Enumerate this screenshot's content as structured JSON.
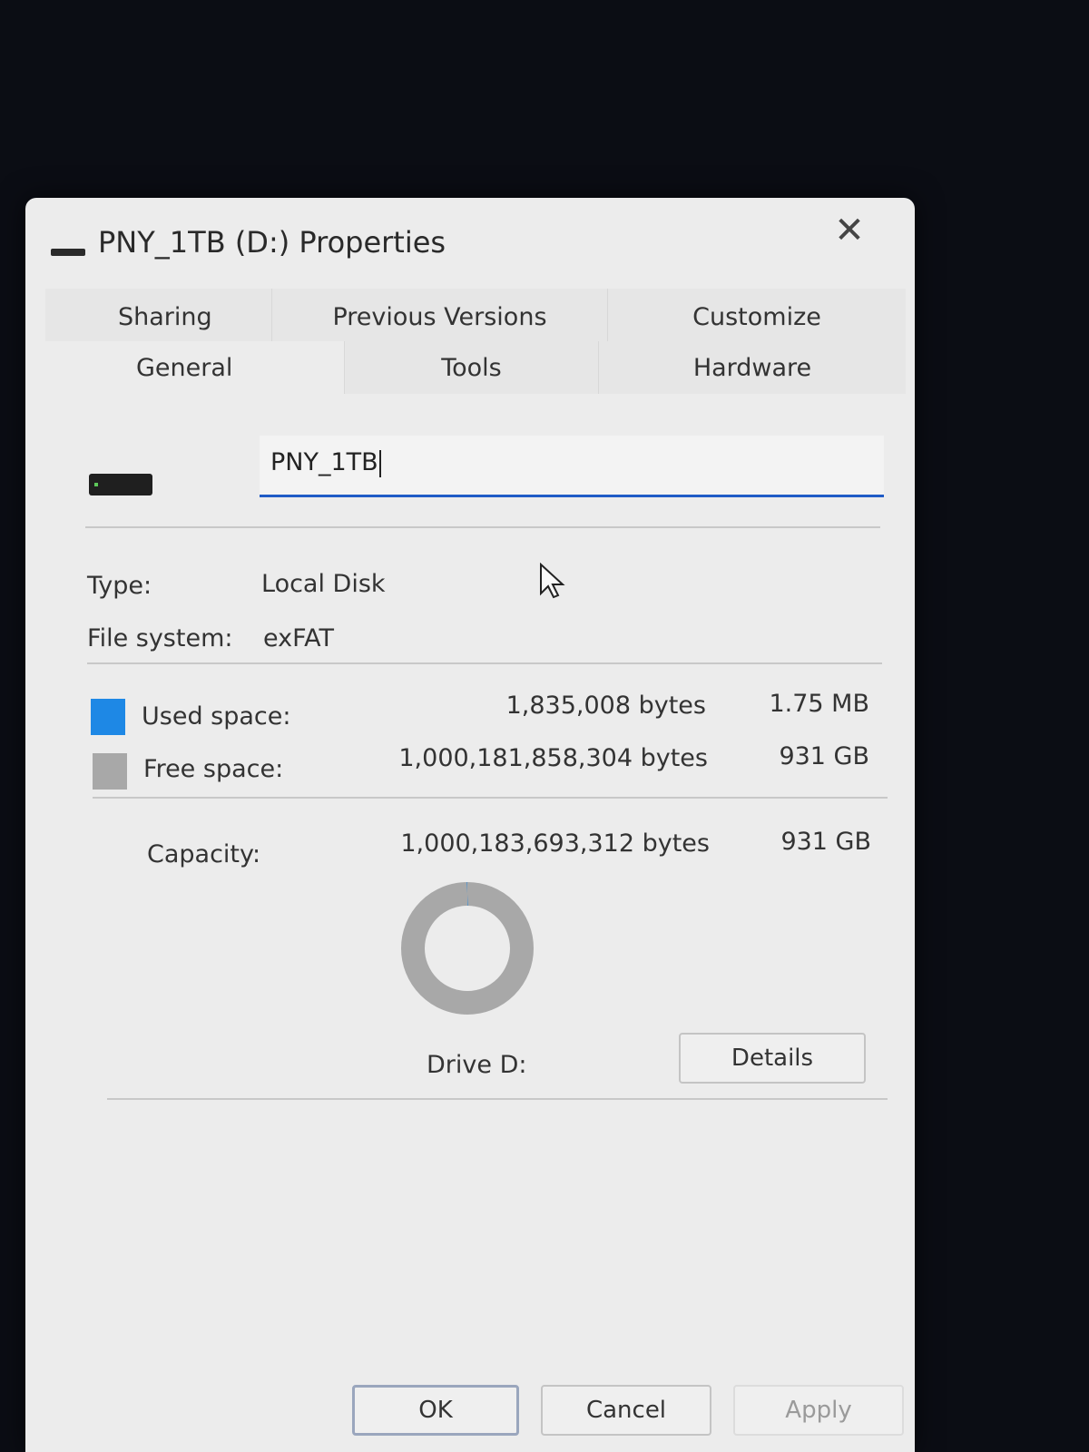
{
  "window": {
    "title": "PNY_1TB (D:) Properties",
    "close_glyph": "✕"
  },
  "tabs": {
    "row1": [
      {
        "label": "Sharing"
      },
      {
        "label": "Previous Versions"
      },
      {
        "label": "Customize"
      }
    ],
    "row2": [
      {
        "label": "General",
        "active": true
      },
      {
        "label": "Tools"
      },
      {
        "label": "Hardware"
      }
    ]
  },
  "general": {
    "name_value": "PNY_1TB",
    "type_label": "Type:",
    "type_value": "Local Disk",
    "fs_label": "File system:",
    "fs_value": "exFAT",
    "used_label": "Used space:",
    "used_bytes": "1,835,008 bytes",
    "used_size": "1.75 MB",
    "free_label": "Free space:",
    "free_bytes": "1,000,181,858,304 bytes",
    "free_size": "931 GB",
    "capacity_label": "Capacity:",
    "capacity_bytes": "1,000,183,693,312 bytes",
    "capacity_size": "931 GB",
    "drive_label": "Drive D:",
    "details_button": "Details",
    "used_fraction": 1.8e-06
  },
  "colors": {
    "used": "#1e88e5",
    "free": "#a8a8a8",
    "accent": "#1f5bc6"
  },
  "footer": {
    "ok_label": "OK",
    "cancel_label": "Cancel",
    "apply_label": "Apply"
  }
}
